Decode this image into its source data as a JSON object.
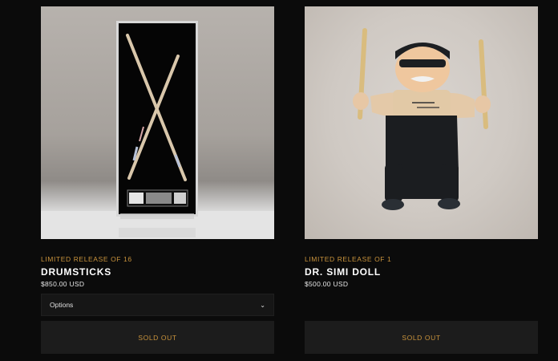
{
  "products": [
    {
      "image_icon": "drumsticks-frame-image",
      "edition": "LIMITED RELEASE OF 16",
      "title": "DRUMSTICKS",
      "price": "$850.00 USD",
      "options_label": "Options",
      "button_label": "SOLD OUT"
    },
    {
      "image_icon": "dr-simi-doll-image",
      "edition": "LIMITED RELEASE OF 1",
      "title": "DR. SIMI DOLL",
      "price": "$500.00 USD",
      "button_label": "SOLD OUT"
    }
  ],
  "colors": {
    "background": "#0b0b0b",
    "accent": "#c9933c",
    "button_bg": "#1c1c1c"
  }
}
